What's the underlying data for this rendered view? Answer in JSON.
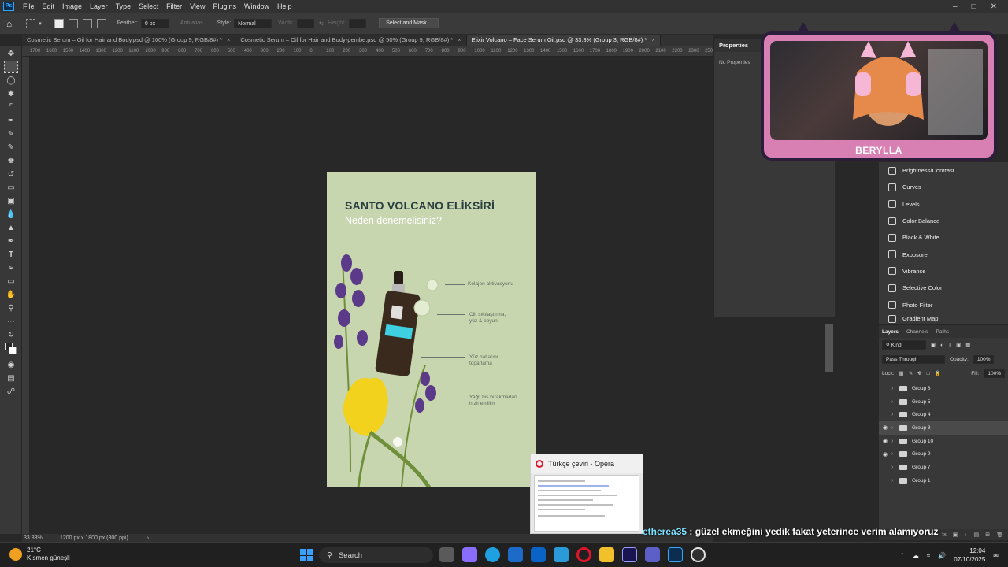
{
  "menubar": {
    "logo": "Ps",
    "items": [
      "File",
      "Edit",
      "Image",
      "Layer",
      "Type",
      "Select",
      "Filter",
      "View",
      "Plugins",
      "Window",
      "Help"
    ]
  },
  "options": {
    "feather_label": "Feather:",
    "feather_value": "0 px",
    "antialias": "Anti-alias",
    "style_label": "Style:",
    "style_value": "Normal",
    "width_label": "Width:",
    "height_label": "Height:",
    "select_mask": "Select and Mask..."
  },
  "tabs": [
    {
      "label": "Cosmetic Serum – Oil for Hair and Body.psd @ 100% (Group 9, RGB/8#) *",
      "active": false
    },
    {
      "label": "Cosmetic Serum – Oil for Hair and Body-pembe.psd @ 50% (Group 9, RGB/8#) *",
      "active": false
    },
    {
      "label": "Elixir Volcano – Face Serum Oil.psd @ 33.3% (Group 3, RGB/8#) *",
      "active": true
    }
  ],
  "ruler": [
    "1700",
    "1600",
    "1500",
    "1400",
    "1300",
    "1200",
    "1100",
    "1000",
    "900",
    "800",
    "700",
    "600",
    "500",
    "400",
    "300",
    "200",
    "100",
    "0",
    "100",
    "200",
    "300",
    "400",
    "500",
    "600",
    "700",
    "800",
    "900",
    "1000",
    "1100",
    "1200",
    "1300",
    "1400",
    "1500",
    "1600",
    "1700",
    "1800",
    "1900",
    "2000",
    "2100",
    "2200",
    "2300",
    "2500"
  ],
  "artboard": {
    "title": "SANTO VOLCANO ELİKSİRİ",
    "subtitle": "Neden denemelisiniz?",
    "labels": [
      "Kolajen aktivasyonu",
      "Cilt sıkılaştırma, yüz & boyun",
      "Yüz hatlarını toparlama",
      "Yağlı his bırakmadan hızlı emilim"
    ],
    "colors": {
      "bg": "#c8d6b0",
      "title": "#2a3d3f",
      "flower_purple": "#5b3a8a",
      "flower_yellow": "#f2d21c",
      "bottle": "#3a2a1e",
      "bottle_label": "#3ed0e0"
    }
  },
  "status": {
    "zoom": "33.33%",
    "doc_info": "1200 px x 1800 px (300 ppi)"
  },
  "properties": {
    "title": "Properties",
    "body": "No Properties"
  },
  "webcam": {
    "name": "BERYLLA"
  },
  "adjustments": [
    {
      "label": "Brightness/Contrast",
      "icon": "sun-icon"
    },
    {
      "label": "Curves",
      "icon": "curves-icon"
    },
    {
      "label": "Levels",
      "icon": "levels-icon"
    },
    {
      "label": "Color Balance",
      "icon": "balance-icon"
    },
    {
      "label": "Black & White",
      "icon": "bw-icon"
    },
    {
      "label": "Exposure",
      "icon": "exposure-icon"
    },
    {
      "label": "Vibrance",
      "icon": "vibrance-icon"
    },
    {
      "label": "Selective Color",
      "icon": "selective-color-icon"
    },
    {
      "label": "Photo Filter",
      "icon": "camera-icon"
    },
    {
      "label": "Gradient Map",
      "icon": "gradient-icon"
    }
  ],
  "layers": {
    "tabs": [
      "Layers",
      "Channels",
      "Paths"
    ],
    "kind": "Kind",
    "blend": "Pass Through",
    "opacity_label": "Opacity:",
    "opacity_value": "100%",
    "lock_label": "Lock:",
    "fill_label": "Fill:",
    "fill_value": "100%",
    "items": [
      {
        "name": "Group 6",
        "visible": false,
        "active": false
      },
      {
        "name": "Group 5",
        "visible": false,
        "active": false
      },
      {
        "name": "Group 4",
        "visible": false,
        "active": false
      },
      {
        "name": "Group 3",
        "visible": true,
        "active": true
      },
      {
        "name": "Group 10",
        "visible": true,
        "active": false
      },
      {
        "name": "Group 9",
        "visible": true,
        "active": false
      },
      {
        "name": "Group 7",
        "visible": false,
        "active": false
      },
      {
        "name": "Group 1",
        "visible": false,
        "active": false
      }
    ]
  },
  "opera_preview": {
    "title": "Türkçe çeviri - Opera"
  },
  "chat": {
    "user": "etherea35",
    "message": " : güzel ekmeğini yedik fakat yeterince verim alamıyoruz"
  },
  "taskbar": {
    "weather_temp": "21°C",
    "weather_desc": "Kısmen güneşli",
    "search_placeholder": "Search",
    "time": "12:04",
    "date": "07/10/2025",
    "apps": [
      {
        "name": "task-view-icon",
        "color": "#5a5a5a"
      },
      {
        "name": "copilot-icon",
        "color": "#8a6cff"
      },
      {
        "name": "edge-icon",
        "color": "#1fa0e0"
      },
      {
        "name": "store-icon",
        "color": "#1e6ac8"
      },
      {
        "name": "outlook-icon",
        "color": "#0a64c8"
      },
      {
        "name": "monitor-icon",
        "color": "#2a9ad8"
      },
      {
        "name": "opera-icon",
        "color": "#e0142a"
      },
      {
        "name": "explorer-icon",
        "color": "#f2c02a"
      },
      {
        "name": "after-effects-icon",
        "color": "#1a1450"
      },
      {
        "name": "teams-icon",
        "color": "#5b5fc7"
      },
      {
        "name": "photoshop-icon",
        "color": "#0c2d4f"
      },
      {
        "name": "obs-icon",
        "color": "#303030"
      }
    ]
  }
}
